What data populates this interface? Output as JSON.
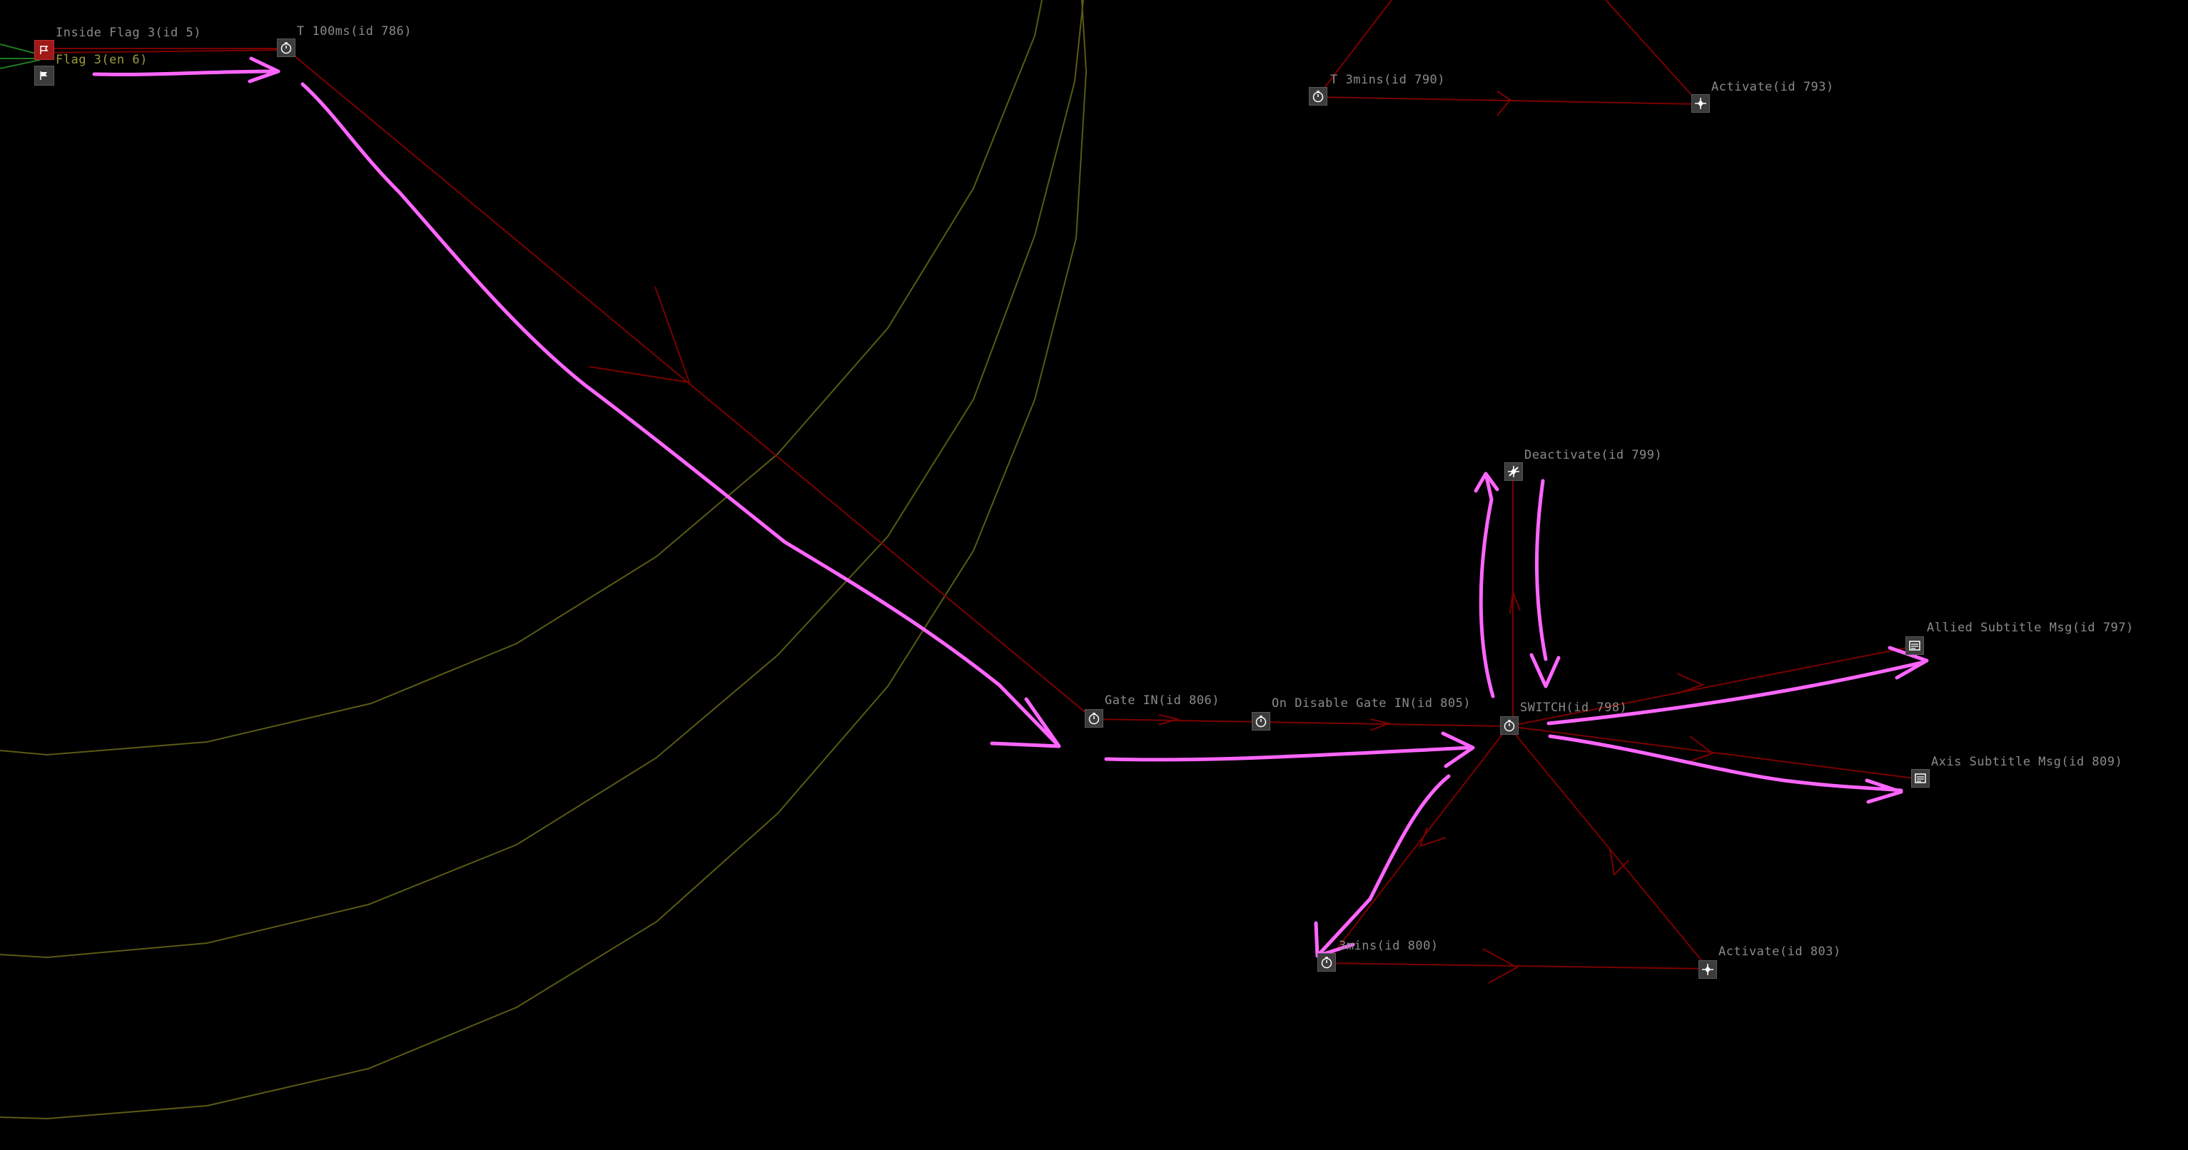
{
  "colors": {
    "background": "#000000",
    "link": "#7a0000",
    "zone_outline": "#5a5a14",
    "annotation": "#ff66ff",
    "label": "#8a8a8a",
    "node_box": "#3c3c3c",
    "flag_red": "#a01818"
  },
  "nodes": [
    {
      "id": "inside-flag-3",
      "label": "Inside Flag 3(id 5)",
      "icon": "flag-red-icon"
    },
    {
      "id": "flag-3",
      "label": "Flag 3(en 6)",
      "icon": "flag-white-icon"
    },
    {
      "id": "t-100ms",
      "label": "T 100ms(id 786)",
      "icon": "timer-icon"
    },
    {
      "id": "t-3mins-790",
      "label": "T 3mins(id 790)",
      "icon": "timer-icon"
    },
    {
      "id": "activate-793",
      "label": "Activate(id 793)",
      "icon": "activate-icon"
    },
    {
      "id": "deactivate-799",
      "label": "Deactivate(id 799)",
      "icon": "deactivate-icon"
    },
    {
      "id": "allied-subtitle-797",
      "label": "Allied Subtitle Msg(id 797)",
      "icon": "message-icon"
    },
    {
      "id": "gate-in-806",
      "label": "Gate IN(id 806)",
      "icon": "timer-icon"
    },
    {
      "id": "on-disable-gate-805",
      "label": "On Disable Gate IN(id 805)",
      "icon": "timer-icon"
    },
    {
      "id": "switch-798",
      "label": "SWITCH(id 798)",
      "icon": "timer-icon"
    },
    {
      "id": "axis-subtitle-809",
      "label": "Axis Subtitle Msg(id 809)",
      "icon": "message-icon"
    },
    {
      "id": "t-3mins-800",
      "label": "3mins(id 800)",
      "icon": "timer-icon"
    },
    {
      "id": "activate-803",
      "label": "Activate(id 803)",
      "icon": "activate-icon"
    }
  ]
}
